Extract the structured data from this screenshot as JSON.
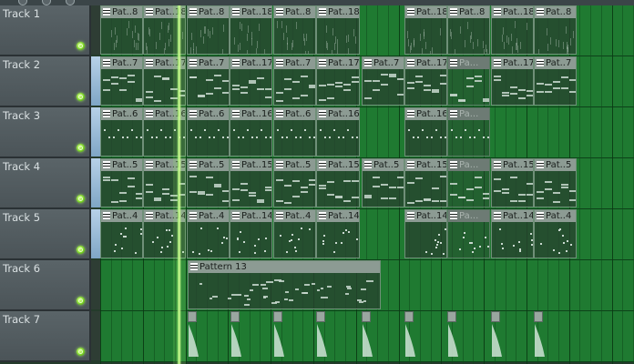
{
  "tracks": [
    {
      "name": "Track 1"
    },
    {
      "name": "Track 2"
    },
    {
      "name": "Track 3"
    },
    {
      "name": "Track 4"
    },
    {
      "name": "Track 5"
    },
    {
      "name": "Track 6"
    },
    {
      "name": "Track 7"
    }
  ],
  "selected_tracks": [
    1,
    2,
    3,
    4
  ],
  "clips": [
    [
      {
        "label": "Pat..8"
      },
      {
        "label": "Pat..18"
      },
      {
        "label": "Pat..8"
      },
      {
        "label": "Pat..18"
      },
      {
        "label": "Pat..8"
      },
      {
        "label": "Pat..18"
      },
      {
        "label": "Pat..18"
      },
      {
        "label": "Pat..8"
      },
      {
        "label": "Pat..18"
      },
      {
        "label": "Pat..8"
      }
    ],
    [
      {
        "label": "Pat..7"
      },
      {
        "label": "Pat..17"
      },
      {
        "label": "Pat..7"
      },
      {
        "label": "Pat..17"
      },
      {
        "label": "Pat..7"
      },
      {
        "label": "Pat..17"
      },
      {
        "label": "Pat..7"
      },
      {
        "label": "Pat..17"
      },
      {
        "label": "Pa..."
      },
      {
        "label": "Pat..17"
      },
      {
        "label": "Pat..7"
      }
    ],
    [
      {
        "label": "Pat..6"
      },
      {
        "label": "Pat..16"
      },
      {
        "label": "Pat..6"
      },
      {
        "label": "Pat..16"
      },
      {
        "label": "Pat..6"
      },
      {
        "label": "Pat..16"
      },
      {
        "label": "Pat..16"
      },
      {
        "label": "Pa..."
      }
    ],
    [
      {
        "label": "Pat..5"
      },
      {
        "label": "Pat..15"
      },
      {
        "label": "Pat..5"
      },
      {
        "label": "Pat..15"
      },
      {
        "label": "Pat..5"
      },
      {
        "label": "Pat..15"
      },
      {
        "label": "Pat..5"
      },
      {
        "label": "Pat..15"
      },
      {
        "label": "Pa..."
      },
      {
        "label": "Pat..15"
      },
      {
        "label": "Pat..5"
      }
    ],
    [
      {
        "label": "Pat..4"
      },
      {
        "label": "Pat..14"
      },
      {
        "label": "Pat..4"
      },
      {
        "label": "Pat..14"
      },
      {
        "label": "Pat..4"
      },
      {
        "label": "Pat..14"
      },
      {
        "label": "Pat..14"
      },
      {
        "label": "Pa..."
      },
      {
        "label": "Pat..14"
      },
      {
        "label": "Pat..4"
      }
    ],
    [
      {
        "label": "Pattern 13"
      }
    ]
  ],
  "colors": {
    "lane": "#1f7a31",
    "grid_line": "#0f4a1c",
    "clip_title": "#8c9b93",
    "led": "#7fd92a",
    "playhead": "#a7f07a",
    "selected_strip": "#9fbedc"
  },
  "icons": {
    "clip": "pattern-clip-icon",
    "mute": "track-led-icon"
  }
}
